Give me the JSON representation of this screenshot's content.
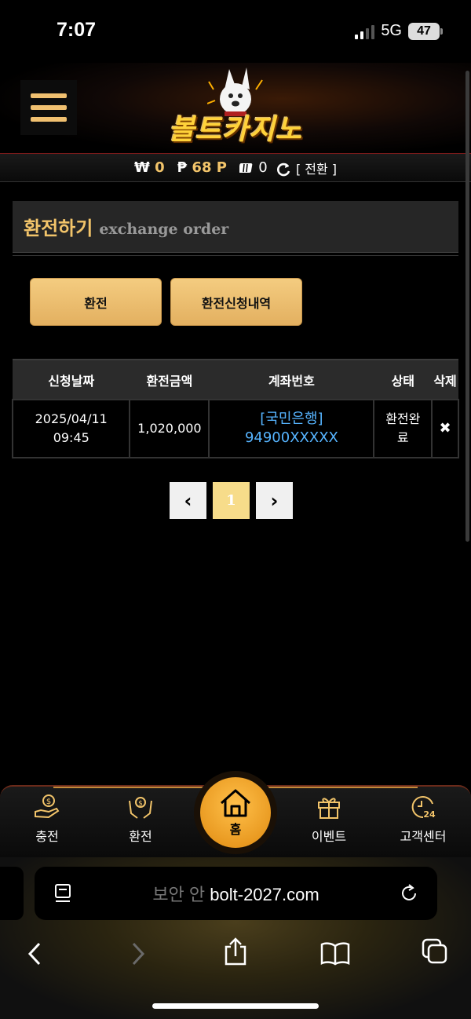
{
  "status_bar": {
    "time": "7:07",
    "network": "5G",
    "battery": "47"
  },
  "header": {
    "logo_text": "볼트카지노",
    "menu_icon": "hamburger-icon"
  },
  "wallet": {
    "won_symbol": "₩",
    "won_amount": "0",
    "point_symbol": "₱",
    "point_amount": "68 P",
    "chip_amount": "0",
    "convert_label": "[ 전환 ]"
  },
  "panel": {
    "title_ko": "환전하기",
    "title_en": "exchange order"
  },
  "actions": {
    "exchange_label": "환전",
    "history_label": "환전신청내역"
  },
  "table": {
    "headers": [
      "신청날짜",
      "환전금액",
      "계좌번호",
      "상태",
      "삭제"
    ],
    "rows": [
      {
        "date": "2025/04/11",
        "time": "09:45",
        "amount": "1,020,000",
        "bank": "[국민은행]",
        "account": "94900XXXXX",
        "status": "환전완료",
        "delete": "✖"
      }
    ]
  },
  "pagination": {
    "prev": "‹",
    "current": "1",
    "next": "›"
  },
  "bottom_nav": {
    "items": [
      {
        "label": "충전",
        "icon": "charge-icon"
      },
      {
        "label": "환전",
        "icon": "exchange-icon"
      },
      {
        "label": "홈",
        "icon": "home-icon"
      },
      {
        "label": "이벤트",
        "icon": "gift-icon"
      },
      {
        "label": "고객센터",
        "icon": "support-24-icon"
      }
    ]
  },
  "browser": {
    "url_faded": "보안 안 ",
    "url": "bolt-2027.com"
  },
  "colors": {
    "gold": "#f2c46a",
    "link": "#56b4ff",
    "button": "#f0c676"
  }
}
